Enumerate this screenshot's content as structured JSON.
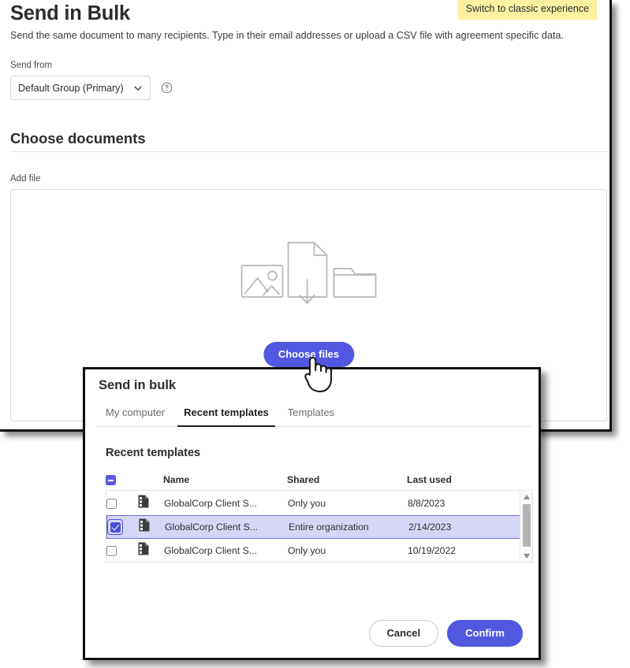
{
  "banner": {
    "label": "Switch to classic experience"
  },
  "page": {
    "title": "Send in Bulk",
    "subtitle": "Send the same document to many recipients. Type in their email addresses or upload a CSV file with agreement specific data.",
    "send_from_label": "Send from",
    "send_from_value": "Default Group (Primary)",
    "section_title": "Choose documents",
    "add_file_label": "Add file",
    "choose_files_label": "Choose files"
  },
  "icons": {
    "chevron": "chevron-down-icon",
    "help": "help-circle-icon",
    "image": "image-icon",
    "document_download": "document-download-icon",
    "folder": "folder-icon",
    "file": "document-icon",
    "cursor": "hand-cursor-icon",
    "scroll_up": "scroll-up-arrow-icon",
    "scroll_down": "scroll-down-arrow-icon"
  },
  "colors": {
    "accent": "#5257e0",
    "checkbox": "#4b4fd8",
    "selected_row": "#d6d7f6",
    "banner": "#faf2a0"
  },
  "modal": {
    "title": "Send in bulk",
    "tabs": [
      {
        "label": "My computer",
        "active": false
      },
      {
        "label": "Recent templates",
        "active": true
      },
      {
        "label": "Templates",
        "active": false
      }
    ],
    "list_heading": "Recent templates",
    "columns": [
      "Name",
      "Shared",
      "Last used"
    ],
    "select_all_state": "indeterminate",
    "rows": [
      {
        "checked": false,
        "name": "GlobalCorp Client S...",
        "shared": "Only you",
        "last_used": "8/8/2023"
      },
      {
        "checked": true,
        "name": "GlobalCorp Client S...",
        "shared": "Entire organization",
        "last_used": "2/14/2023"
      },
      {
        "checked": false,
        "name": "GlobalCorp Client S...",
        "shared": "Only you",
        "last_used": "10/19/2022"
      }
    ],
    "cancel_label": "Cancel",
    "confirm_label": "Confirm"
  }
}
